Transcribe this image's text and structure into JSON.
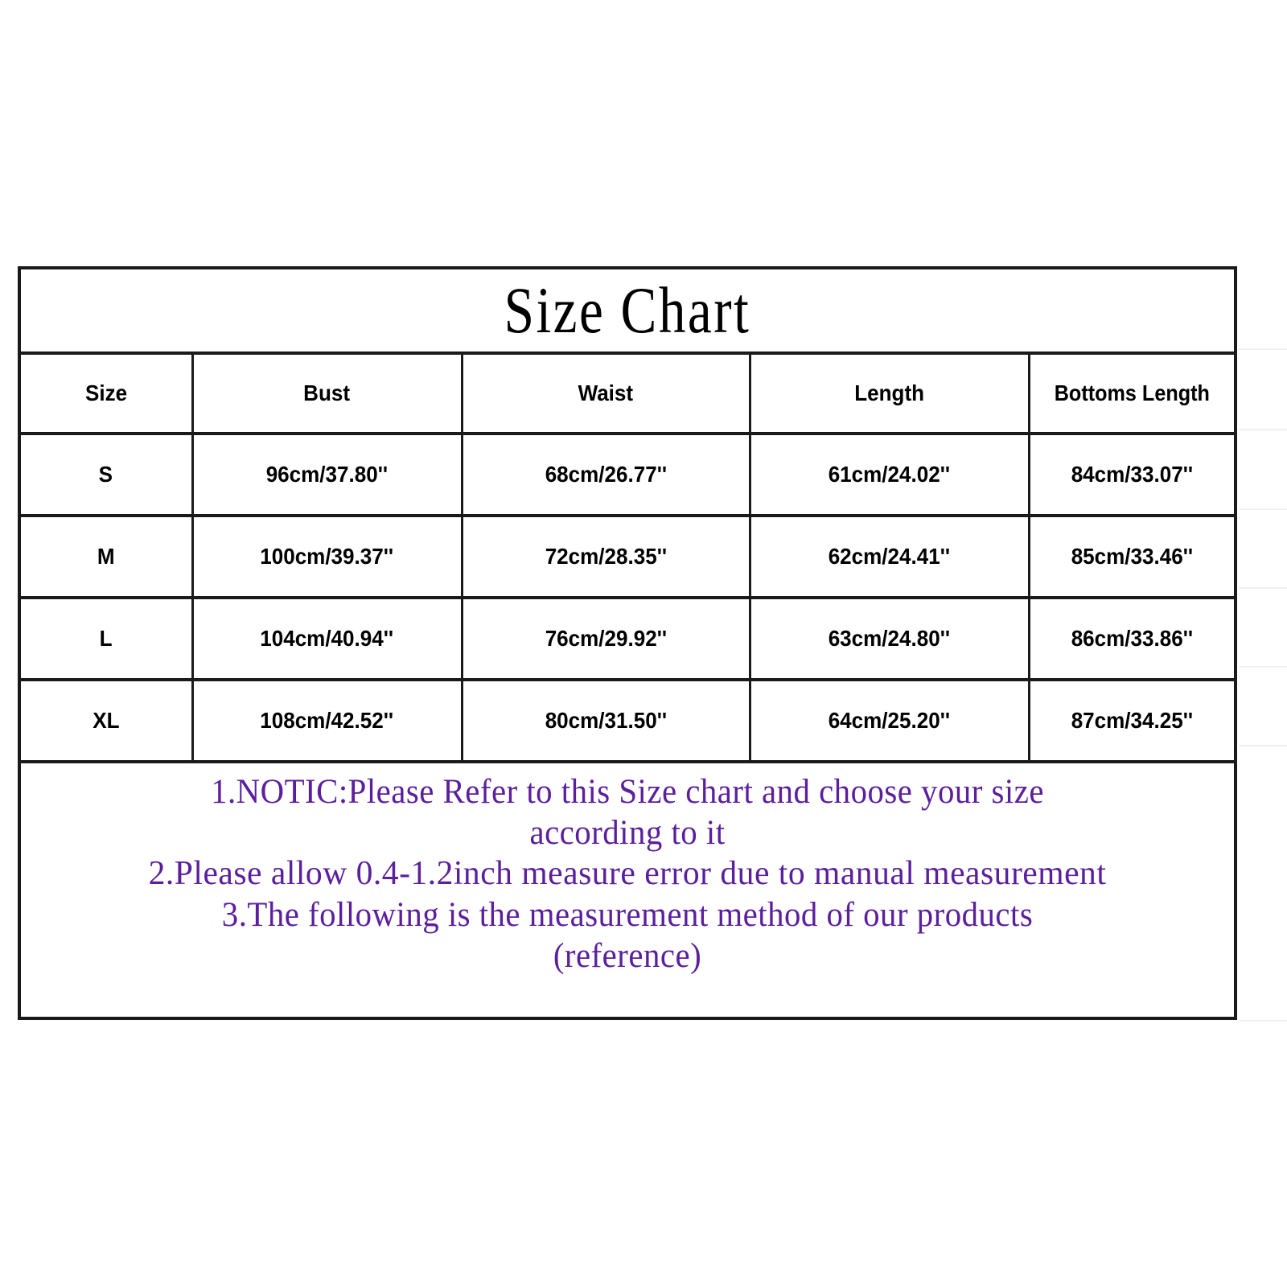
{
  "chart": {
    "title": "Size Chart",
    "accent_color": "#5b1f9e",
    "border_color": "#1a1a1a",
    "text_color": "#000000",
    "background": "#ffffff"
  },
  "chart_data": {
    "type": "table",
    "title": "Size Chart",
    "columns": [
      "Size",
      "Bust",
      "Waist",
      "Length",
      "Bottoms Length"
    ],
    "rows": [
      {
        "size": "S",
        "bust": "96cm/37.80''",
        "waist": "68cm/26.77''",
        "length": "61cm/24.02''",
        "bottoms_length": "84cm/33.07''"
      },
      {
        "size": "M",
        "bust": "100cm/39.37''",
        "waist": "72cm/28.35''",
        "length": "62cm/24.41''",
        "bottoms_length": "85cm/33.46''"
      },
      {
        "size": "L",
        "bust": "104cm/40.94''",
        "waist": "76cm/29.92''",
        "length": "63cm/24.80''",
        "bottoms_length": "86cm/33.86''"
      },
      {
        "size": "XL",
        "bust": "108cm/42.52''",
        "waist": "80cm/31.50''",
        "length": "64cm/25.20''",
        "bottoms_length": "87cm/34.25''"
      }
    ]
  },
  "notes": {
    "line1": "1.NOTIC:Please Refer to this Size chart and choose your size",
    "line2": "according to it",
    "line3": "2.Please allow 0.4-1.2inch measure error due to manual measurement",
    "line4": "3.The following is the measurement method of our products",
    "line5": "(reference)"
  }
}
